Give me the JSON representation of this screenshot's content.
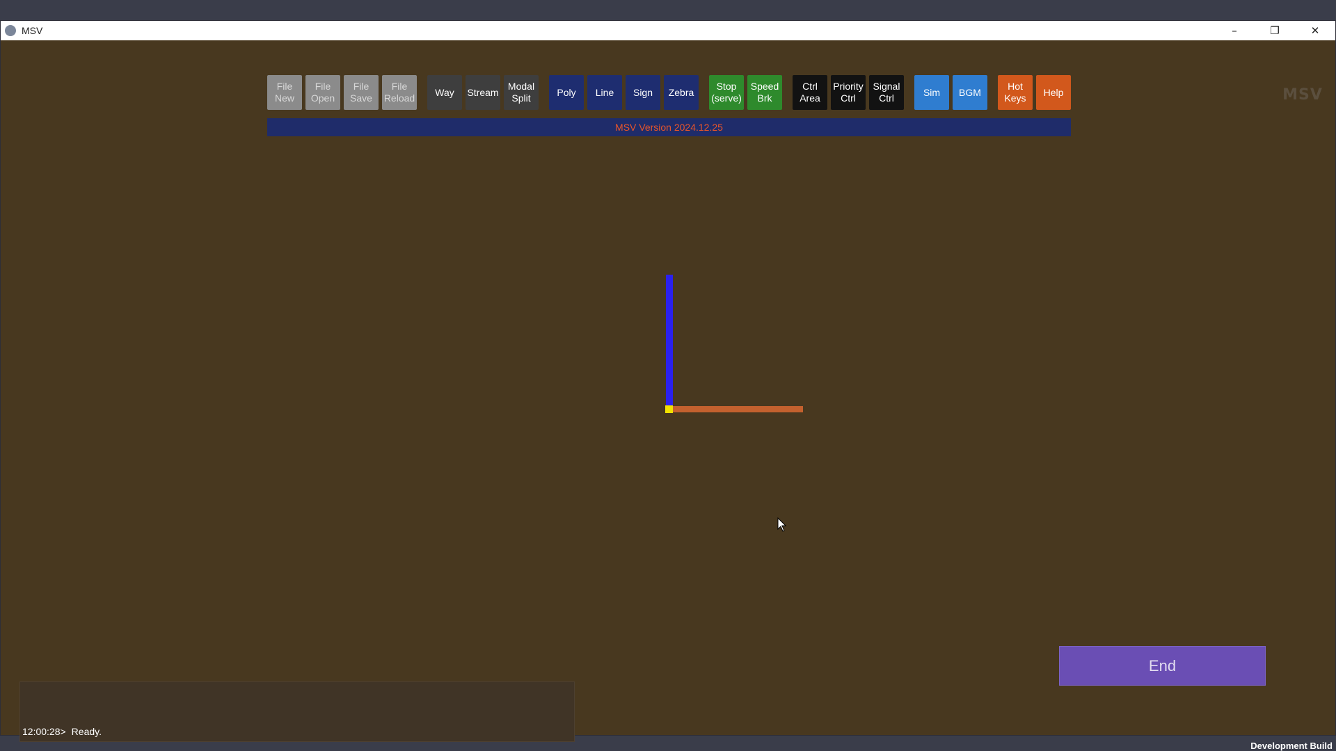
{
  "window": {
    "title": "MSV",
    "controls": [
      "–",
      "❐",
      "✕"
    ]
  },
  "toolbar": {
    "buttons": [
      {
        "label": "File\nNew",
        "group": "file"
      },
      {
        "label": "File\nOpen",
        "group": "file"
      },
      {
        "label": "File\nSave",
        "group": "file"
      },
      {
        "label": "File\nReload",
        "group": "file"
      },
      {
        "label": "Way",
        "group": "way"
      },
      {
        "label": "Stream",
        "group": "way"
      },
      {
        "label": "Modal\nSplit",
        "group": "way"
      },
      {
        "label": "Poly",
        "group": "poly"
      },
      {
        "label": "Line",
        "group": "poly"
      },
      {
        "label": "Sign",
        "group": "poly"
      },
      {
        "label": "Zebra",
        "group": "poly"
      },
      {
        "label": "Stop\n(serve)",
        "group": "stop"
      },
      {
        "label": "Speed\nBrk",
        "group": "stop"
      },
      {
        "label": "Ctrl\nArea",
        "group": "ctrl"
      },
      {
        "label": "Priority\nCtrl",
        "group": "ctrl"
      },
      {
        "label": "Signal\nCtrl",
        "group": "ctrl"
      },
      {
        "label": "Sim",
        "group": "sim"
      },
      {
        "label": "BGM",
        "group": "sim"
      },
      {
        "label": "Hot\nKeys",
        "group": "hot"
      },
      {
        "label": "Help",
        "group": "hot"
      }
    ]
  },
  "version_bar": {
    "text": "MSV Version 2024.12.25"
  },
  "logo": {
    "text": "MSV"
  },
  "canvas": {
    "colors": {
      "vertical_line": "#2a20ef",
      "horizontal_line": "#c4612e",
      "node": "#f2e200"
    }
  },
  "end_button": {
    "label": "End"
  },
  "log": {
    "time": "12:00:28>",
    "message": "Ready."
  },
  "footer": {
    "build_label": "Development Build"
  }
}
